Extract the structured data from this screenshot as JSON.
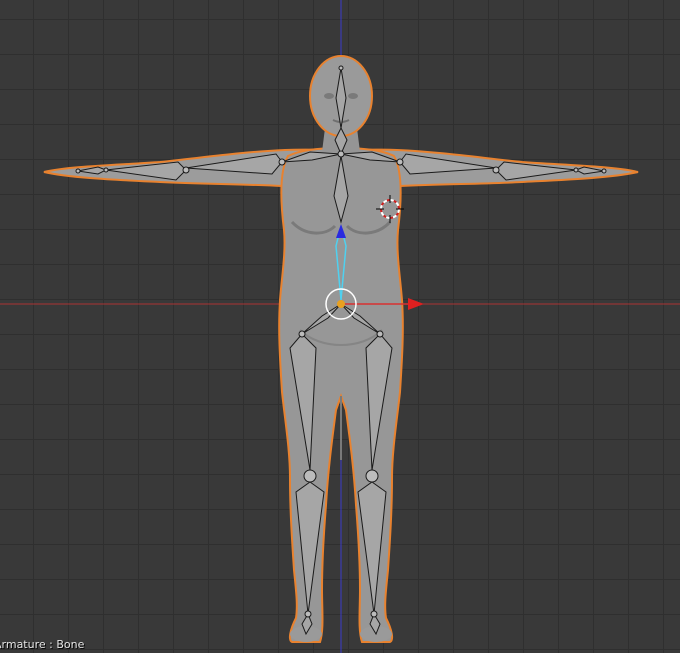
{
  "viewport": {
    "status": "Armature : Bone",
    "axis_colors": {
      "x_axis": "#c23b3b",
      "y_axis": "#2b2bd9"
    },
    "mesh_colors": {
      "body_fill": "#9a9a9a",
      "body_shade": "#7d7d7d",
      "selection_outline": "#e8822f",
      "bone_fill": "#a3a3a3",
      "bone_stroke": "#1a1a1a",
      "active_bone": "#4fd1f0"
    },
    "widgets": {
      "manipulator": "translate-manipulator",
      "cursor": "3d-cursor-icon",
      "arrow_x": "x-arrow-icon",
      "arrow_y": "y-arrow-icon"
    }
  }
}
